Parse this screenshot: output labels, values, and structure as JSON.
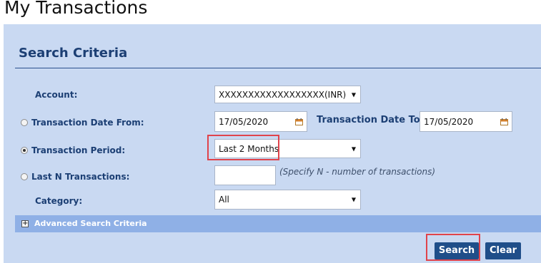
{
  "page_title": "My Transactions",
  "section_title": "Search Criteria",
  "account": {
    "label": "Account:",
    "value": "XXXXXXXXXXXXXXXXXX(INR)"
  },
  "date_from": {
    "label": "Transaction Date From:",
    "value": "17/05/2020"
  },
  "date_to": {
    "label": "Transaction Date To:",
    "value": "17/05/2020"
  },
  "period": {
    "label": "Transaction Period:",
    "value": "Last 2 Months",
    "selected": true
  },
  "last_n": {
    "label": "Last N Transactions:",
    "value": "",
    "hint": "(Specify N - number of transactions)"
  },
  "category": {
    "label": "Category:",
    "value": "All"
  },
  "advanced": {
    "label": "Advanced Search Criteria"
  },
  "buttons": {
    "search": "Search",
    "clear": "Clear"
  },
  "colors": {
    "panel_bg": "#c9d9f2",
    "label_text": "#1c3f74",
    "button_bg": "#1f4e89",
    "advanced_bar": "#8fb0e6",
    "highlight": "#e0434b"
  },
  "icons": {
    "calendar": "calendar-icon",
    "dropdown": "chevron-down-icon",
    "expand": "plus-icon"
  }
}
